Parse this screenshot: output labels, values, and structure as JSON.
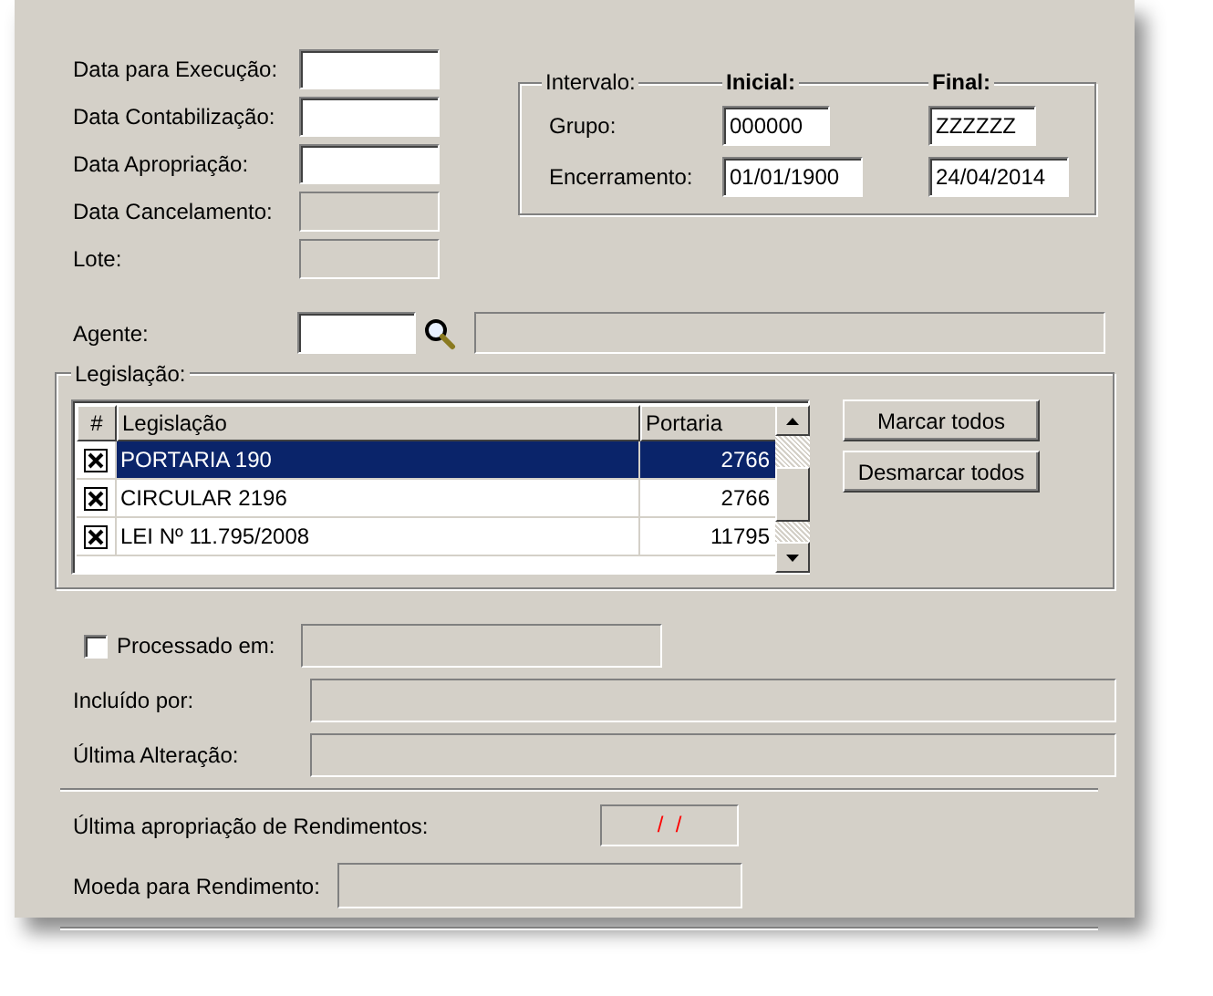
{
  "dates": [
    {
      "label": "Data para Execução:",
      "disabled": false
    },
    {
      "label": "Data Contabilização:",
      "disabled": false
    },
    {
      "label": "Data Apropriação:",
      "disabled": false
    },
    {
      "label": "Data Cancelamento:",
      "disabled": true
    },
    {
      "label": "Lote:",
      "disabled": true
    }
  ],
  "interval": {
    "legend": "Intervalo:",
    "start_heading": "Inicial:",
    "end_heading": "Final:",
    "rows": [
      {
        "label": "Grupo:",
        "start": "000000",
        "end": "ZZZZZZ"
      },
      {
        "label": "Encerramento:",
        "start": "01/01/1900",
        "end": "24/04/2014"
      }
    ]
  },
  "agent": {
    "label": "Agente:"
  },
  "legislation": {
    "legend": "Legislação:",
    "columns": [
      "#",
      "Legislação",
      "Portaria"
    ],
    "rows": [
      {
        "checked": true,
        "selected": true,
        "name": "PORTARIA 190",
        "portaria": "2766"
      },
      {
        "checked": true,
        "selected": false,
        "name": "CIRCULAR 2196",
        "portaria": "2766"
      },
      {
        "checked": true,
        "selected": false,
        "name": "LEI Nº 11.795/2008",
        "portaria": "11795"
      }
    ],
    "buttons": [
      "Marcar todos",
      "Desmarcar todos"
    ]
  },
  "processed": {
    "label": "Processado em:",
    "checked": false
  },
  "audit": [
    {
      "label": "Incluído por:"
    },
    {
      "label": "Última Alteração:"
    }
  ],
  "income": [
    {
      "label": "Última apropriação de Rendimentos:",
      "value": "/  /"
    },
    {
      "label": "Moeda para Rendimento:"
    }
  ]
}
